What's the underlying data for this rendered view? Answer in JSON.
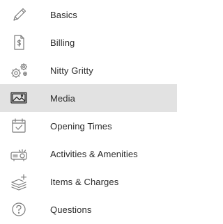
{
  "menu": {
    "items": [
      {
        "label": "Basics",
        "icon": "pencil-icon",
        "active": false
      },
      {
        "label": "Billing",
        "icon": "invoice-dollar-icon",
        "active": false
      },
      {
        "label": "Nitty Gritty",
        "icon": "gears-icon",
        "active": false
      },
      {
        "label": "Media",
        "icon": "image-icon",
        "active": true
      },
      {
        "label": "Opening Times",
        "icon": "calendar-check-icon",
        "active": false
      },
      {
        "label": "Activities & Amenities",
        "icon": "projector-icon",
        "active": false
      },
      {
        "label": "Items & Charges",
        "icon": "layers-plus-icon",
        "active": false
      },
      {
        "label": "Questions",
        "icon": "question-circle-icon",
        "active": false
      }
    ]
  },
  "colors": {
    "active_background": "#e2e2e2",
    "icon_stroke": "#7a7a7a",
    "active_icon_stroke": "#2b2b2b",
    "label_text": "#2b2b2b"
  }
}
